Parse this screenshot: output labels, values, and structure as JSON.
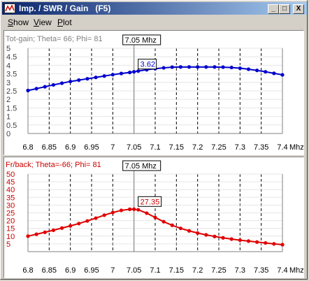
{
  "window": {
    "title": "Imp. / SWR / Gain   (F5)",
    "buttons": {
      "minimize": "_",
      "maximize": "□",
      "close": "X"
    }
  },
  "menu": [
    {
      "label": "Show",
      "accel": "S",
      "rest": "how"
    },
    {
      "label": "View",
      "accel": "V",
      "rest": "iew"
    },
    {
      "label": "Plot",
      "accel": "P",
      "rest": "lot"
    }
  ],
  "chart_data": [
    {
      "type": "line",
      "title": "Tot-gain; Theta= 66; Phi= 81",
      "cursor_label": "7.05 Mhz",
      "cursor_value_label": "3.62",
      "x_unit": "Mhz",
      "x_ticks": [
        "6.8",
        "6.85",
        "6.9",
        "6.95",
        "7",
        "7.05",
        "7.1",
        "7.15",
        "7.2",
        "7.25",
        "7.3",
        "7.35",
        "7.4"
      ],
      "y_ticks": [
        "0",
        "0.5",
        "1",
        "1.5",
        "2",
        "2.5",
        "3",
        "3.5",
        "4",
        "4.5",
        "5"
      ],
      "xlim": [
        6.8,
        7.4
      ],
      "ylim": [
        0,
        5
      ],
      "color": "#0000cc",
      "series": [
        {
          "x": [
            6.8,
            6.82,
            6.84,
            6.86,
            6.88,
            6.9,
            6.92,
            6.94,
            6.96,
            6.98,
            7.0,
            7.02,
            7.04,
            7.05,
            7.06,
            7.08,
            7.1,
            7.12,
            7.14,
            7.16,
            7.18,
            7.2,
            7.22,
            7.24,
            7.26,
            7.28,
            7.3,
            7.32,
            7.34,
            7.36,
            7.38,
            7.4
          ],
          "y": [
            2.52,
            2.63,
            2.74,
            2.85,
            2.95,
            3.05,
            3.13,
            3.21,
            3.29,
            3.37,
            3.45,
            3.52,
            3.58,
            3.62,
            3.66,
            3.74,
            3.8,
            3.85,
            3.89,
            3.9,
            3.9,
            3.9,
            3.9,
            3.9,
            3.89,
            3.87,
            3.83,
            3.77,
            3.7,
            3.62,
            3.53,
            3.44
          ]
        }
      ]
    },
    {
      "type": "line",
      "title": "Fr/back; Theta=-66; Phi= 81",
      "cursor_label": "7.05 Mhz",
      "cursor_value_label": "27.35",
      "x_unit": "Mhz",
      "x_ticks": [
        "6.8",
        "6.85",
        "6.9",
        "6.95",
        "7",
        "7.05",
        "7.1",
        "7.15",
        "7.2",
        "7.25",
        "7.3",
        "7.35",
        "7.4"
      ],
      "y_ticks": [
        "5",
        "10",
        "15",
        "20",
        "25",
        "30",
        "35",
        "40",
        "45",
        "50"
      ],
      "xlim": [
        6.8,
        7.4
      ],
      "ylim": [
        0,
        50
      ],
      "color": "#e00000",
      "series": [
        {
          "x": [
            6.8,
            6.82,
            6.84,
            6.86,
            6.88,
            6.9,
            6.92,
            6.94,
            6.96,
            6.98,
            7.0,
            7.02,
            7.04,
            7.05,
            7.06,
            7.08,
            7.1,
            7.12,
            7.14,
            7.16,
            7.18,
            7.2,
            7.22,
            7.24,
            7.26,
            7.28,
            7.3,
            7.32,
            7.34,
            7.36,
            7.38,
            7.4
          ],
          "y": [
            10.0,
            11.2,
            12.5,
            13.8,
            15.2,
            16.6,
            18.1,
            19.8,
            21.6,
            23.5,
            25.2,
            26.6,
            27.3,
            27.35,
            27.0,
            24.8,
            22.0,
            19.3,
            17.0,
            15.0,
            13.4,
            12.0,
            10.8,
            9.8,
            8.9,
            8.1,
            7.4,
            6.8,
            6.2,
            5.6,
            5.0,
            4.5
          ]
        }
      ]
    }
  ]
}
